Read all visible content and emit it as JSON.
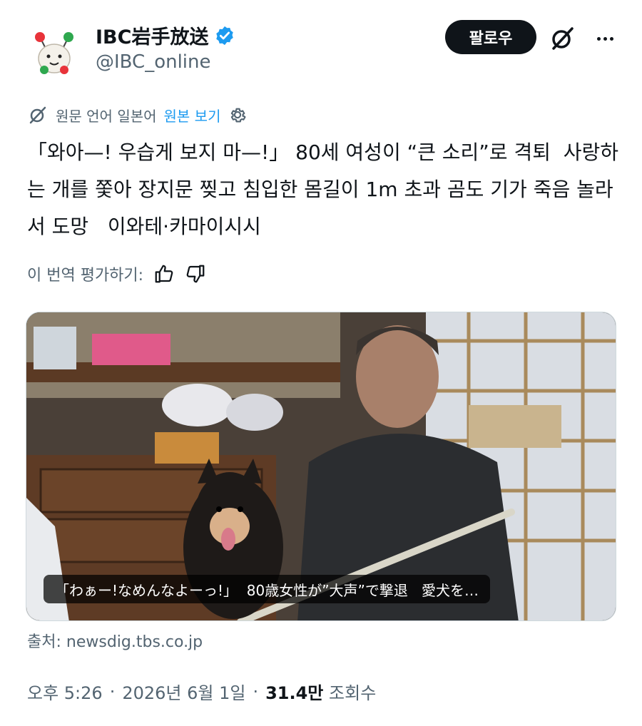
{
  "account": {
    "display_name": "IBC岩手放送",
    "handle": "@IBC_online",
    "verified": true
  },
  "actions": {
    "follow_label": "팔로우",
    "grok_icon": "grok-icon",
    "more_icon": "more-icon"
  },
  "translation": {
    "notice": "원문 언어 일본어",
    "show_original": "원본 보기",
    "rate_prompt": "이 번역 평가하기:"
  },
  "tweet": {
    "text": "「와아—! 우습게 보지 마—!」 80세 여성이 “큰 소리”로 격퇴  사랑하는 개를 쫓아 장지문 찢고 침입한 몸길이 1m 초과 곰도 기가 죽음 놀라서 도망   이와테·카마이시시"
  },
  "media": {
    "caption": "「わぁー!なめんなよーっ!」  80歳女性が”大声”で撃退   愛犬を…",
    "source": "출처: newsdig.tbs.co.jp"
  },
  "meta": {
    "time": "오후 5:26",
    "date": "2026년 6월 1일",
    "sep": "·",
    "views_count": "31.4만",
    "views_label": "조회수"
  },
  "colors": {
    "text": "#0f1419",
    "secondary": "#536471",
    "link": "#1d9bf0",
    "follow_bg": "#0f1419"
  }
}
